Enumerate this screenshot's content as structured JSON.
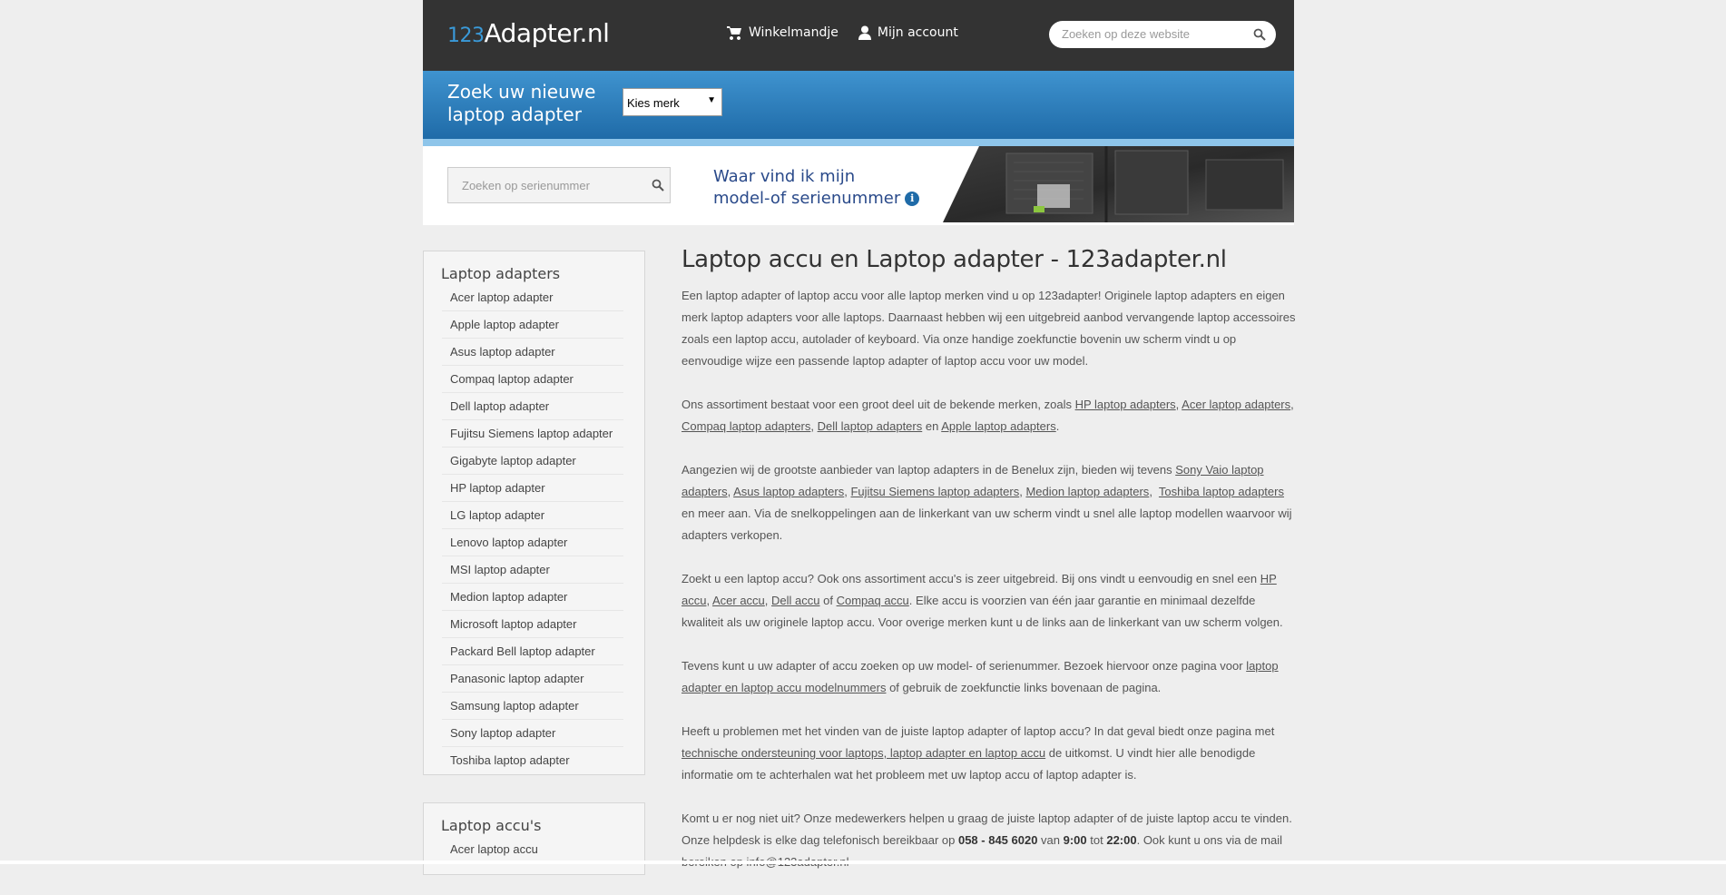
{
  "header": {
    "logo_prefix": "123",
    "logo_main": "Adapter.nl",
    "cart_label": "Winkelmandje",
    "account_label": "Mijn account",
    "search_placeholder": "Zoeken op deze website"
  },
  "finder": {
    "title_line1": "Zoek uw nieuwe",
    "title_line2": "laptop adapter",
    "brand_select": "Kies merk"
  },
  "serial": {
    "placeholder": "Zoeken op serienummer",
    "info_line1": "Waar vind ik mijn",
    "info_line2": "model-of serienummer"
  },
  "sidebar": {
    "adapters_title": "Laptop adapters",
    "adapters": [
      "Acer laptop adapter",
      "Apple laptop adapter",
      "Asus laptop adapter",
      "Compaq laptop adapter",
      "Dell laptop adapter",
      "Fujitsu Siemens laptop adapter",
      "Gigabyte laptop adapter",
      "HP laptop adapter",
      "LG laptop adapter",
      "Lenovo laptop adapter",
      "MSI laptop adapter",
      "Medion laptop adapter",
      "Microsoft laptop adapter",
      "Packard Bell laptop adapter",
      "Panasonic laptop adapter",
      "Samsung laptop adapter",
      "Sony laptop adapter",
      "Toshiba laptop adapter"
    ],
    "accus_title": "Laptop accu's",
    "accus": [
      "Acer laptop accu"
    ]
  },
  "main": {
    "title": "Laptop accu en Laptop adapter - 123adapter.nl",
    "p1": "Een laptop adapter of laptop accu voor alle laptop merken vind u op 123adapter! Originele laptop adapters en eigen merk laptop adapters voor alle laptops. Daarnaast hebben wij een uitgebreid aanbod vervangende laptop accessoires zoals een laptop accu, autolader of keyboard. Via onze handige zoekfunctie bovenin uw scherm vindt u op eenvoudige wijze een passende laptop adapter of laptop accu voor uw model.",
    "p2": {
      "t1": "Ons assortiment bestaat voor een groot deel uit de bekende merken, zoals ",
      "l1": "HP laptop adapters",
      "s1": ", ",
      "l2": "Acer laptop adapters",
      "s2": ", ",
      "l3": "Compaq laptop adapters",
      "s3": ", ",
      "l4": "Dell laptop adapters",
      "s4": " en ",
      "l5": "Apple laptop adapters",
      "t2": "."
    },
    "p3": {
      "t1": "Aangezien wij de grootste aanbieder van laptop adapters in de Benelux zijn, bieden wij tevens ",
      "l1": "Sony Vaio laptop adapters",
      "s1": ", ",
      "l2": "Asus laptop adapters",
      "s2": ", ",
      "l3": "Fujitsu Siemens laptop adapters",
      "s3": ", ",
      "l4": "Medion laptop adapters",
      "s4": ",  ",
      "l5": "Toshiba laptop adapters",
      "t2": " en meer aan. Via de snelkoppelingen aan de linkerkant van uw scherm vindt u snel alle laptop modellen waarvoor wij adapters verkopen."
    },
    "p4": {
      "t1": "Zoekt u een laptop accu? Ook ons assortiment accu's is zeer uitgebreid. Bij ons vindt u eenvoudig en snel een ",
      "l1": "HP accu",
      "s1": ", ",
      "l2": "Acer accu",
      "s2": ", ",
      "l3": "Dell accu",
      "s3": " of ",
      "l4": "Compaq accu",
      "t2": ". Elke accu is voorzien van één jaar garantie en minimaal dezelfde kwaliteit als uw originele laptop accu. Voor overige merken kunt u de links aan de linkerkant van uw scherm volgen."
    },
    "p5": {
      "t1": "Tevens kunt u uw adapter of accu zoeken op uw model- of serienummer. Bezoek hiervoor onze pagina voor ",
      "l1": "laptop adapter en laptop accu modelnummers",
      "t2": " of gebruik de zoekfunctie links bovenaan de pagina."
    },
    "p6": {
      "t1": "Heeft u problemen met het vinden van de juiste laptop adapter of laptop accu? In dat geval biedt onze pagina met ",
      "l1": "technische ondersteuning voor laptops, laptop adapter en laptop accu",
      "t2": " de uitkomst. U vindt hier alle benodigde informatie om te achterhalen wat het probleem met uw laptop accu of laptop adapter is."
    },
    "p7": {
      "t1": "Komt u er nog niet uit? Onze medewerkers helpen u graag de juiste laptop adapter of de juiste laptop accu te vinden. Onze helpdesk is elke dag telefonisch bereikbaar op ",
      "phone": "058 - 845 6020",
      "t2": " van ",
      "from": "9:00",
      "t3": " tot ",
      "to": "22:00",
      "t4": ". Ook kunt u ons via de mail bereiken op info@123adapter.nl"
    }
  }
}
